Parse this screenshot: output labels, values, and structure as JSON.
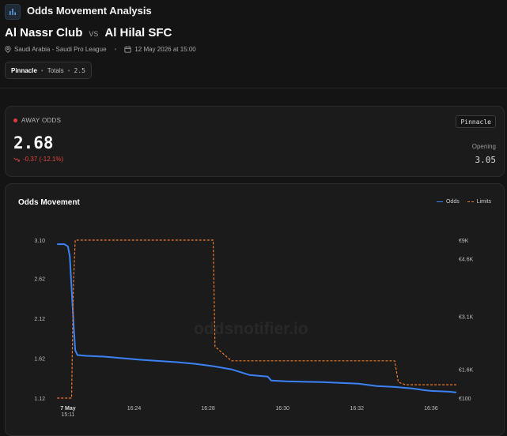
{
  "header": {
    "title": "Odds Movement Analysis",
    "home_team": "Al Nassr Club",
    "vs": "vs",
    "away_team": "Al Hilal SFC",
    "league": "Saudi Arabia - Saudi Pro League",
    "datetime": "12 May 2026 at 15:00",
    "icons": {
      "app": "bar-chart-icon",
      "location": "map-pin-icon",
      "date": "calendar-icon"
    }
  },
  "filter": {
    "bookmaker": "Pinnacle",
    "market": "Totals",
    "line": "2.5"
  },
  "odds_card": {
    "label": "AWAY ODDS",
    "current": "2.68",
    "change": "-0.37 (-12.1%)",
    "bookmaker": "Pinnacle",
    "opening_label": "Opening",
    "opening_value": "3.05",
    "icons": {
      "trend": "trend-down-icon"
    }
  },
  "colors": {
    "odds": "#3b82f6",
    "limits": "#f07a2a",
    "negative": "#e0443e",
    "card_bg": "#1b1b1b"
  },
  "chart": {
    "title": "Odds Movement",
    "watermark": "oddsnotifier.io",
    "legend": {
      "odds": "Odds",
      "limits": "Limits"
    }
  },
  "chart_data": {
    "type": "line",
    "x_ticks": [
      {
        "label": "7 May",
        "sub": "15:11",
        "t": 0
      },
      {
        "label": "16:24",
        "sub": "",
        "t": 18.2
      },
      {
        "label": "16:28",
        "sub": "",
        "t": 38.6
      },
      {
        "label": "16:30",
        "sub": "",
        "t": 59.1
      },
      {
        "label": "16:32",
        "sub": "",
        "t": 79.6
      },
      {
        "label": "16:36",
        "sub": "",
        "t": 100
      }
    ],
    "y_left_ticks": [
      "3.10",
      "2.62",
      "2.12",
      "1.62",
      "1.12"
    ],
    "y_left_range": [
      1.12,
      3.1
    ],
    "y_right_ticks": [
      {
        "label": "€9K",
        "value": 9000
      },
      {
        "label": "€4.6K",
        "value": 7950
      },
      {
        "label": "€3.1K",
        "value": 4700
      },
      {
        "label": "€1.6K",
        "value": 1720
      },
      {
        "label": "€100",
        "value": 100
      }
    ],
    "y_right_range": [
      100,
      9000
    ],
    "x_range": [
      -5,
      107
    ],
    "series": [
      {
        "name": "Odds",
        "axis": "left",
        "points": [
          [
            -3,
            3.05
          ],
          [
            -1,
            3.05
          ],
          [
            0,
            3.02
          ],
          [
            0.5,
            2.9
          ],
          [
            1,
            2.5
          ],
          [
            1.6,
            2.0
          ],
          [
            2,
            1.72
          ],
          [
            2.6,
            1.66
          ],
          [
            5,
            1.65
          ],
          [
            10,
            1.64
          ],
          [
            20,
            1.6
          ],
          [
            30,
            1.57
          ],
          [
            35,
            1.55
          ],
          [
            40,
            1.52
          ],
          [
            45,
            1.48
          ],
          [
            50,
            1.41
          ],
          [
            55,
            1.39
          ],
          [
            56,
            1.34
          ],
          [
            60,
            1.33
          ],
          [
            70,
            1.32
          ],
          [
            75,
            1.31
          ],
          [
            80,
            1.3
          ],
          [
            85,
            1.27
          ],
          [
            90,
            1.26
          ],
          [
            95,
            1.24
          ],
          [
            98,
            1.22
          ],
          [
            100,
            1.21
          ],
          [
            105,
            1.2
          ],
          [
            107,
            1.19
          ]
        ]
      },
      {
        "name": "Limits",
        "axis": "right",
        "step": true,
        "points": [
          [
            -3,
            100
          ],
          [
            1,
            100
          ],
          [
            1.5,
            6500
          ],
          [
            2,
            9000
          ],
          [
            40,
            9000
          ],
          [
            40.5,
            3000
          ],
          [
            45,
            2200
          ],
          [
            90,
            2200
          ],
          [
            91,
            1000
          ],
          [
            93,
            850
          ],
          [
            107,
            850
          ]
        ]
      }
    ]
  }
}
